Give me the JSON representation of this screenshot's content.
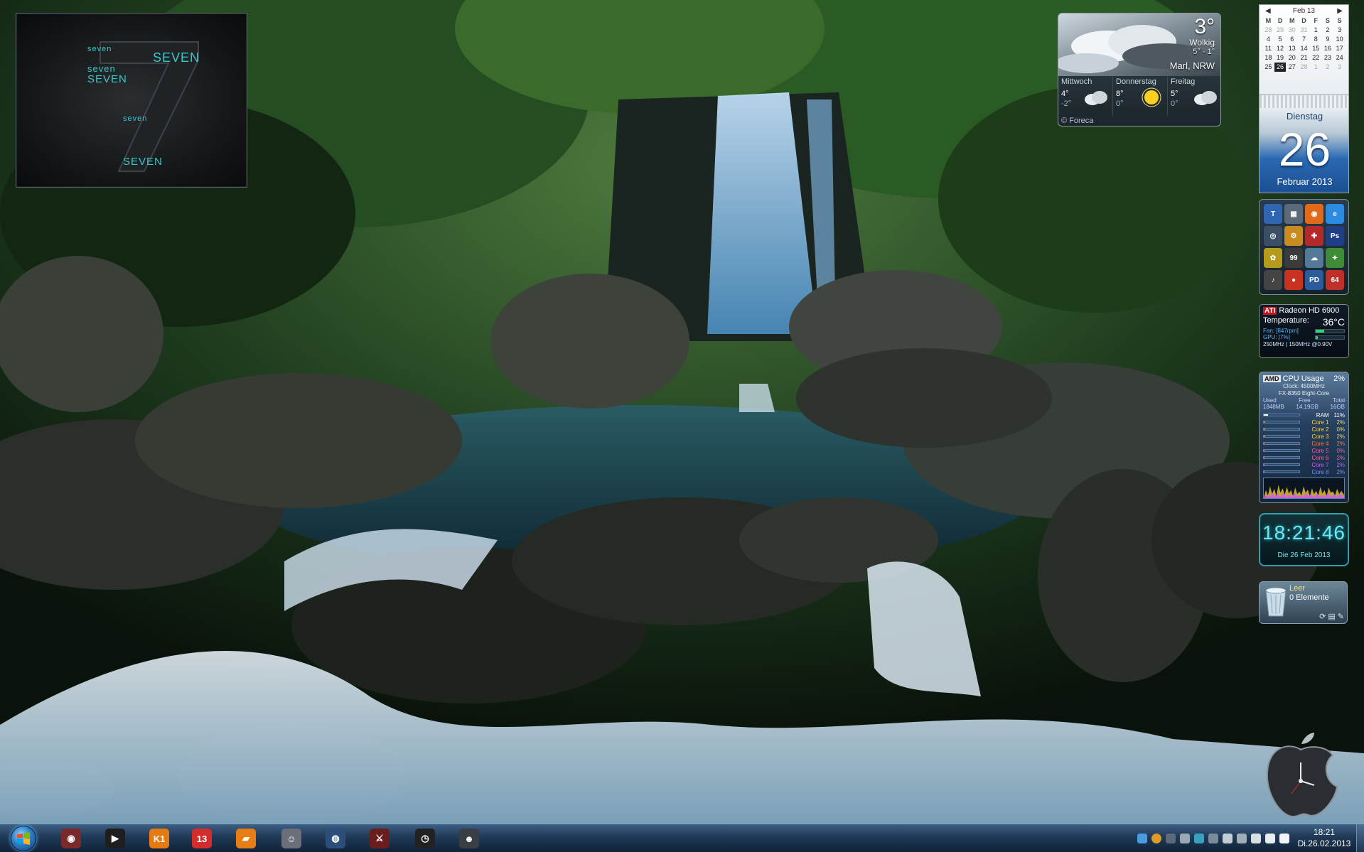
{
  "seven_widget": {
    "tags": [
      "seven",
      "SEVEN",
      "seven",
      "SEVEN",
      "seven",
      "SEVEN"
    ]
  },
  "weather": {
    "temperature": "3°",
    "condition": "Wolkig",
    "range": "5° - 1°",
    "location": "Marl, NRW",
    "forecast": [
      {
        "day": "Mittwoch",
        "high": "4°",
        "low": "-2°",
        "icon": "cloud-icon"
      },
      {
        "day": "Donnerstag",
        "high": "8°",
        "low": "0°",
        "icon": "sun-icon"
      },
      {
        "day": "Freitag",
        "high": "5°",
        "low": "0°",
        "icon": "cloud-icon"
      }
    ],
    "provider": "© Foreca"
  },
  "calendar": {
    "month_label": "Feb 13",
    "weekdays": [
      "M",
      "D",
      "M",
      "D",
      "F",
      "S",
      "S"
    ],
    "weeks": [
      [
        "28",
        "29",
        "30",
        "31",
        "1",
        "2",
        "3"
      ],
      [
        "4",
        "5",
        "6",
        "7",
        "8",
        "9",
        "10"
      ],
      [
        "11",
        "12",
        "13",
        "14",
        "15",
        "16",
        "17"
      ],
      [
        "18",
        "19",
        "20",
        "21",
        "22",
        "23",
        "24"
      ],
      [
        "25",
        "26",
        "27",
        "28",
        "1",
        "2",
        "3"
      ]
    ],
    "weekday_name": "Dienstag",
    "day_number": "26",
    "month_year": "Februar 2013"
  },
  "launcher": {
    "apps": [
      {
        "name": "tool-app",
        "label": "T",
        "color": "#2f66b3"
      },
      {
        "name": "folder-app",
        "label": "▦",
        "color": "#5a6a7a"
      },
      {
        "name": "firefox-app",
        "label": "◉",
        "color": "#e06a1a"
      },
      {
        "name": "ie-app",
        "label": "e",
        "color": "#2a8be0"
      },
      {
        "name": "steam-app",
        "label": "◎",
        "color": "#3a4f66"
      },
      {
        "name": "gear-app",
        "label": "⚙",
        "color": "#c98a20"
      },
      {
        "name": "shield-app",
        "label": "✚",
        "color": "#b42a2a"
      },
      {
        "name": "ps-app",
        "label": "Ps",
        "color": "#1e3f85"
      },
      {
        "name": "game-app",
        "label": "✿",
        "color": "#b59a1c"
      },
      {
        "name": "monitor-app",
        "label": "99",
        "color": "#3b3b3b"
      },
      {
        "name": "cloud-app",
        "label": "☁",
        "color": "#547b96"
      },
      {
        "name": "leaf-app",
        "label": "✦",
        "color": "#3e8c35"
      },
      {
        "name": "music-app",
        "label": "♪",
        "color": "#444"
      },
      {
        "name": "chrome-app",
        "label": "●",
        "color": "#c8321f"
      },
      {
        "name": "pd-app",
        "label": "PD",
        "color": "#2b5b9a"
      },
      {
        "name": "sixtyfour-app",
        "label": "64",
        "color": "#c0302a"
      }
    ]
  },
  "gpu": {
    "vendor": "ATI",
    "model": "Radeon HD 6900",
    "temperature_label": "Temperature:",
    "temperature": "36°C",
    "fan_label": "Fan: [847rpm]",
    "fan_level": 0.3,
    "gpu_label": "GPU: [7%]",
    "gpu_level": 0.07,
    "clocks": "250MHz | 150MHz @0.90V"
  },
  "cpu": {
    "vendor": "AMD",
    "title": "CPU Usage",
    "total_usage": "2%",
    "clock": "Clock: 4500MHz",
    "model": "FX-8350 Eight-Core",
    "mem_headers": [
      "Used",
      "Free",
      "Total"
    ],
    "mem_values": [
      "1848MB",
      "14.19GB",
      "16GB"
    ],
    "rows": [
      {
        "label": "RAM",
        "pct": "11%",
        "level": 0.11,
        "color": "#ffffff"
      },
      {
        "label": "Core 1",
        "pct": "2%",
        "level": 0.02,
        "color": "#ffd23a"
      },
      {
        "label": "Core 2",
        "pct": "0%",
        "level": 0.0,
        "color": "#ffd23a"
      },
      {
        "label": "Core 3",
        "pct": "2%",
        "level": 0.02,
        "color": "#ffd23a"
      },
      {
        "label": "Core 4",
        "pct": "2%",
        "level": 0.02,
        "color": "#ff7a3a"
      },
      {
        "label": "Core 5",
        "pct": "0%",
        "level": 0.0,
        "color": "#ff5aa0"
      },
      {
        "label": "Core 6",
        "pct": "2%",
        "level": 0.02,
        "color": "#ff5aa0"
      },
      {
        "label": "Core 7",
        "pct": "2%",
        "level": 0.02,
        "color": "#d05aff"
      },
      {
        "label": "Core 8",
        "pct": "2%",
        "level": 0.02,
        "color": "#7a8aff"
      }
    ]
  },
  "digital_clock": {
    "time": "18:21:46",
    "date": "Die 26 Feb 2013"
  },
  "recycle_bin": {
    "status": "Leer",
    "count": "0 Elemente"
  },
  "taskbar": {
    "pinned": [
      {
        "name": "taskbar-app-game",
        "label": "◉",
        "color": "#7a2a2a"
      },
      {
        "name": "taskbar-app-media-player",
        "label": "▶",
        "color": "#1e1e1e"
      },
      {
        "name": "taskbar-app-k1",
        "label": "K1",
        "color": "#e57a12"
      },
      {
        "name": "taskbar-app-thirteen",
        "label": "13",
        "color": "#d42b2b"
      },
      {
        "name": "taskbar-app-notes",
        "label": "▰",
        "color": "#e67d16"
      },
      {
        "name": "taskbar-app-avatar",
        "label": "☺",
        "color": "#6b6f7a"
      },
      {
        "name": "taskbar-app-browser",
        "label": "◍",
        "color": "#2c4f7a"
      },
      {
        "name": "taskbar-app-fighter",
        "label": "⚔",
        "color": "#6a1d1d"
      },
      {
        "name": "taskbar-app-dial",
        "label": "◷",
        "color": "#222222"
      },
      {
        "name": "taskbar-app-robot",
        "label": "☻",
        "color": "#3a3f46"
      }
    ],
    "clock_time": "18:21",
    "clock_date": "Di.26.02.2013"
  }
}
